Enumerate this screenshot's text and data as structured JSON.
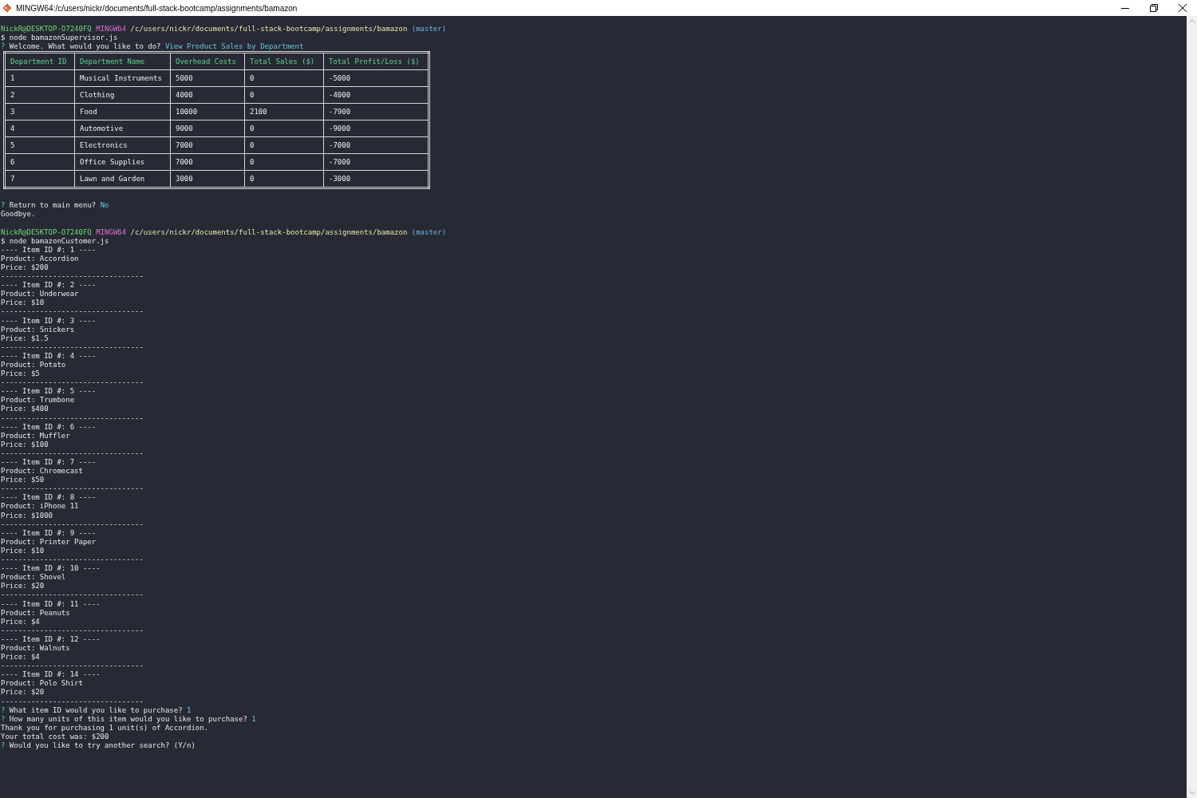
{
  "window": {
    "title": "MINGW64:/c/users/nickr/documents/full-stack-bootcamp/assignments/bamazon"
  },
  "terminal": {
    "lines": [
      {
        "kind": "prompt",
        "user": "NickR@DESKTOP-O7240FQ",
        "system": "MINGW64",
        "path": "/c/users/nickr/documents/full-stack-bootcamp/assignments/bamazon",
        "branch": "(master)"
      },
      {
        "kind": "output",
        "text": "$ node bamazonSupervisor.js"
      },
      {
        "kind": "question",
        "marker": "?",
        "text": "Welcome. What would you like to do?",
        "answer": "View Product Sales by Department"
      },
      {
        "kind": "table",
        "columns": [
          "Department ID",
          "Department Name",
          "Overhead Costs",
          "Total Sales ($)",
          "Total Profit/Loss ($)"
        ],
        "rows": [
          [
            "1",
            "Musical Instruments",
            "5000",
            "0",
            "-5000"
          ],
          [
            "2",
            "Clothing",
            "4000",
            "0",
            "-4000"
          ],
          [
            "3",
            "Food",
            "10000",
            "2100",
            "-7900"
          ],
          [
            "4",
            "Automotive",
            "9000",
            "0",
            "-9000"
          ],
          [
            "5",
            "Electronics",
            "7000",
            "0",
            "-7000"
          ],
          [
            "6",
            "Office Supplies",
            "7000",
            "0",
            "-7000"
          ],
          [
            "7",
            "Lawn and Garden",
            "3000",
            "0",
            "-3000"
          ]
        ]
      },
      {
        "kind": "question",
        "marker": "?",
        "text": "Return to main menu?",
        "answer": "No"
      },
      {
        "kind": "output",
        "text": "Goodbye."
      },
      {
        "kind": "blank"
      },
      {
        "kind": "prompt",
        "user": "NickR@DESKTOP-O7240FQ",
        "system": "MINGW64",
        "path": "/c/users/nickr/documents/full-stack-bootcamp/assignments/bamazon",
        "branch": "(master)"
      },
      {
        "kind": "output",
        "text": "$ node bamazonCustomer.js"
      },
      {
        "kind": "output",
        "text": "---- Item ID #: 1 ----"
      },
      {
        "kind": "output",
        "text": "Product: Accordion"
      },
      {
        "kind": "output",
        "text": "Price: $200"
      },
      {
        "kind": "output",
        "text": "---------------------------------"
      },
      {
        "kind": "output",
        "text": "---- Item ID #: 2 ----"
      },
      {
        "kind": "output",
        "text": "Product: Underwear"
      },
      {
        "kind": "output",
        "text": "Price: $10"
      },
      {
        "kind": "output",
        "text": "---------------------------------"
      },
      {
        "kind": "output",
        "text": "---- Item ID #: 3 ----"
      },
      {
        "kind": "output",
        "text": "Product: Snickers"
      },
      {
        "kind": "output",
        "text": "Price: $1.5"
      },
      {
        "kind": "output",
        "text": "---------------------------------"
      },
      {
        "kind": "output",
        "text": "---- Item ID #: 4 ----"
      },
      {
        "kind": "output",
        "text": "Product: Potato"
      },
      {
        "kind": "output",
        "text": "Price: $5"
      },
      {
        "kind": "output",
        "text": "---------------------------------"
      },
      {
        "kind": "output",
        "text": "---- Item ID #: 5 ----"
      },
      {
        "kind": "output",
        "text": "Product: Trumbone"
      },
      {
        "kind": "output",
        "text": "Price: $400"
      },
      {
        "kind": "output",
        "text": "---------------------------------"
      },
      {
        "kind": "output",
        "text": "---- Item ID #: 6 ----"
      },
      {
        "kind": "output",
        "text": "Product: Muffler"
      },
      {
        "kind": "output",
        "text": "Price: $100"
      },
      {
        "kind": "output",
        "text": "---------------------------------"
      },
      {
        "kind": "output",
        "text": "---- Item ID #: 7 ----"
      },
      {
        "kind": "output",
        "text": "Product: Chromecast"
      },
      {
        "kind": "output",
        "text": "Price: $50"
      },
      {
        "kind": "output",
        "text": "---------------------------------"
      },
      {
        "kind": "output",
        "text": "---- Item ID #: 8 ----"
      },
      {
        "kind": "output",
        "text": "Product: iPhone 11"
      },
      {
        "kind": "output",
        "text": "Price: $1000"
      },
      {
        "kind": "output",
        "text": "---------------------------------"
      },
      {
        "kind": "output",
        "text": "---- Item ID #: 9 ----"
      },
      {
        "kind": "output",
        "text": "Product: Printer Paper"
      },
      {
        "kind": "output",
        "text": "Price: $10"
      },
      {
        "kind": "output",
        "text": "---------------------------------"
      },
      {
        "kind": "output",
        "text": "---- Item ID #: 10 ----"
      },
      {
        "kind": "output",
        "text": "Product: Shovel"
      },
      {
        "kind": "output",
        "text": "Price: $20"
      },
      {
        "kind": "output",
        "text": "---------------------------------"
      },
      {
        "kind": "output",
        "text": "---- Item ID #: 11 ----"
      },
      {
        "kind": "output",
        "text": "Product: Peanuts"
      },
      {
        "kind": "output",
        "text": "Price: $4"
      },
      {
        "kind": "output",
        "text": "---------------------------------"
      },
      {
        "kind": "output",
        "text": "---- Item ID #: 12 ----"
      },
      {
        "kind": "output",
        "text": "Product: Walnuts"
      },
      {
        "kind": "output",
        "text": "Price: $4"
      },
      {
        "kind": "output",
        "text": "---------------------------------"
      },
      {
        "kind": "output",
        "text": "---- Item ID #: 14 ----"
      },
      {
        "kind": "output",
        "text": "Product: Polo Shirt"
      },
      {
        "kind": "output",
        "text": "Price: $20"
      },
      {
        "kind": "output",
        "text": "---------------------------------"
      },
      {
        "kind": "question",
        "marker": "?",
        "text": "What item ID would you like to purchase?",
        "answer": "1"
      },
      {
        "kind": "question",
        "marker": "?",
        "text": "How many units of this item would you like to purchase?",
        "answer": "1"
      },
      {
        "kind": "output",
        "text": "Thank you for purchasing 1 unit(s) of Accordion."
      },
      {
        "kind": "output",
        "text": "Your total cost was: $200"
      },
      {
        "kind": "question",
        "marker": "?",
        "text": "Would you like to try another search? (Y/n)"
      }
    ]
  }
}
